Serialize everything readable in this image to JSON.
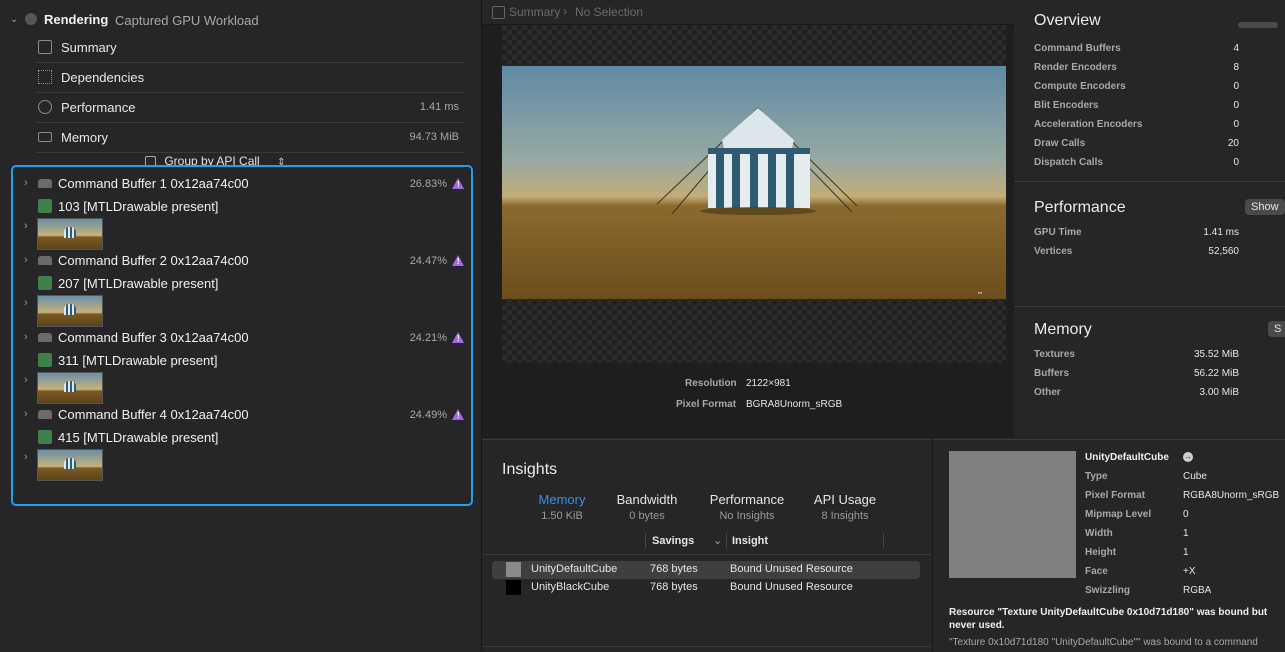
{
  "navigator": {
    "root_title": "Rendering",
    "root_subtitle": "Captured GPU Workload",
    "items": [
      {
        "label": "Summary",
        "value": ""
      },
      {
        "label": "Dependencies",
        "value": ""
      },
      {
        "label": "Performance",
        "value": "1.41 ms"
      },
      {
        "label": "Memory",
        "value": "94.73 MiB"
      }
    ],
    "group_by": "Group by API Call",
    "command_buffers": [
      {
        "label": "Command Buffer 1 0x12aa74c00",
        "percent": "26.83%",
        "draw": "103 [MTLDrawable present]"
      },
      {
        "label": "Command Buffer 2 0x12aa74c00",
        "percent": "24.47%",
        "draw": "207 [MTLDrawable present]"
      },
      {
        "label": "Command Buffer 3 0x12aa74c00",
        "percent": "24.21%",
        "draw": "311 [MTLDrawable present]"
      },
      {
        "label": "Command Buffer 4 0x12aa74c00",
        "percent": "24.49%",
        "draw": "415 [MTLDrawable present]"
      }
    ]
  },
  "breadcrumb": {
    "first": "Summary",
    "second": "No Selection"
  },
  "preview": {
    "resolution_label": "Resolution",
    "resolution_value": "2122×981",
    "format_label": "Pixel Format",
    "format_value": "BGRA8Unorm_sRGB"
  },
  "overview": {
    "title": "Overview",
    "rows": [
      {
        "k": "Command Buffers",
        "v": "4"
      },
      {
        "k": "Render Encoders",
        "v": "8"
      },
      {
        "k": "Compute Encoders",
        "v": "0"
      },
      {
        "k": "Blit Encoders",
        "v": "0"
      },
      {
        "k": "Acceleration Encoders",
        "v": "0"
      },
      {
        "k": "Draw Calls",
        "v": "20"
      },
      {
        "k": "Dispatch Calls",
        "v": "0"
      }
    ]
  },
  "performance": {
    "title": "Performance",
    "show_button": "Show",
    "rows": [
      {
        "k": "GPU Time",
        "v": "1.41 ms"
      },
      {
        "k": "Vertices",
        "v": "52,560"
      }
    ]
  },
  "memory": {
    "title": "Memory",
    "show_button": "S",
    "rows": [
      {
        "k": "Textures",
        "v": "35.52 MiB"
      },
      {
        "k": "Buffers",
        "v": "56.22 MiB"
      },
      {
        "k": "Other",
        "v": "3.00 MiB"
      }
    ]
  },
  "insights": {
    "title": "Insights",
    "tabs": [
      {
        "label": "Memory",
        "sub": "1.50 KiB"
      },
      {
        "label": "Bandwidth",
        "sub": "0 bytes"
      },
      {
        "label": "Performance",
        "sub": "No Insights"
      },
      {
        "label": "API Usage",
        "sub": "8 Insights"
      }
    ],
    "col_savings": "Savings",
    "col_insight": "Insight",
    "rows": [
      {
        "name": "UnityDefaultCube",
        "savings": "768 bytes",
        "insight": "Bound Unused Resource",
        "swatch": "#8a8a8a"
      },
      {
        "name": "UnityBlackCube",
        "savings": "768 bytes",
        "insight": "Bound Unused Resource",
        "swatch": "#000000"
      }
    ]
  },
  "resource": {
    "name": "UnityDefaultCube",
    "props": [
      {
        "k": "Type",
        "v": "Cube"
      },
      {
        "k": "Pixel Format",
        "v": "RGBA8Unorm_sRGB"
      },
      {
        "k": "Mipmap Level",
        "v": "0"
      },
      {
        "k": "Width",
        "v": "1"
      },
      {
        "k": "Height",
        "v": "1"
      },
      {
        "k": "Face",
        "v": "+X"
      },
      {
        "k": "Swizzling",
        "v": "RGBA"
      }
    ],
    "message": "Resource \"Texture UnityDefaultCube 0x10d71d180\" was bound but never used.",
    "detail": "\"Texture 0x10d71d180 \"UnityDefaultCube\"\" was bound to a command"
  },
  "colors": {
    "accent": "#1fa3e8",
    "link": "#3a8ee6",
    "warning": "#a467e6"
  }
}
